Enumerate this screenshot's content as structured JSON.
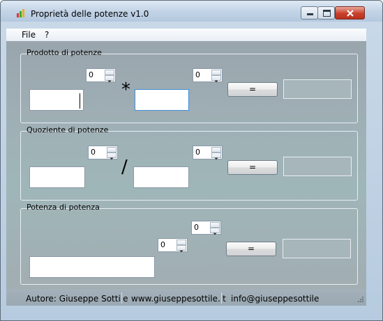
{
  "window": {
    "title": "Proprietà delle potenze v1.0"
  },
  "menu": {
    "file": "File",
    "help": "?"
  },
  "groups": {
    "prodotto": {
      "label": "Prodotto di potenze",
      "spin_a": "0",
      "spin_b": "0",
      "operator": "*",
      "equals": "="
    },
    "quoziente": {
      "label": "Quoziente di potenze",
      "spin_a": "0",
      "spin_b": "0",
      "operator": "/",
      "equals": "="
    },
    "potenza": {
      "label": "Potenza di potenza",
      "spin_a": "0",
      "spin_b": "0",
      "equals": "="
    }
  },
  "status": {
    "author": "Autore: Giuseppe Sottile",
    "website": "www.giuseppesottile.it",
    "email": "info@giuseppesottile"
  },
  "icons": {
    "app": "app-icon",
    "minimize": "minimize-icon",
    "maximize": "maximize-icon",
    "close": "close-icon",
    "spin_up": "spin-up-icon",
    "spin_down": "spin-down-icon",
    "grip": "resize-grip-icon"
  }
}
